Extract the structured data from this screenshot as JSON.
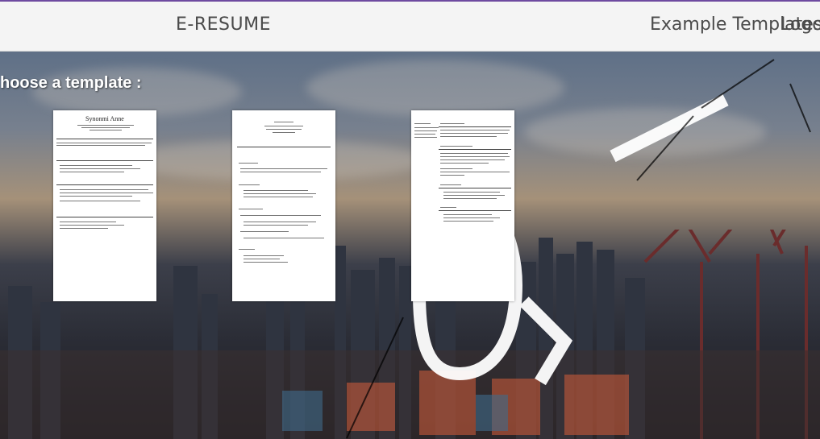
{
  "navbar": {
    "brand": "E-RESUME",
    "links": [
      "Example Templates",
      "Logou"
    ]
  },
  "main": {
    "heading": "hoose a template :"
  },
  "templates": [
    {
      "name": "Synonmi Anne"
    },
    {
      "name": ""
    },
    {
      "name": ""
    }
  ],
  "colors": {
    "accent_line": "#6e4aa0",
    "navbar_bg": "#f4f4f4",
    "text_dark": "#4a4a4a"
  }
}
